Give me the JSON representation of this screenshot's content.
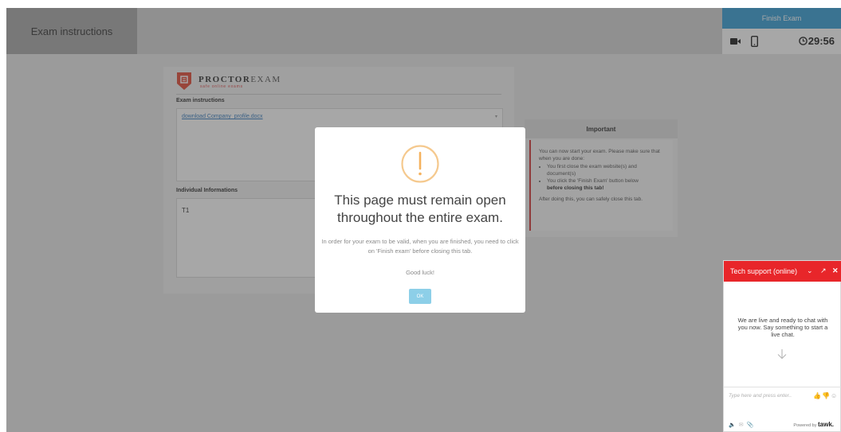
{
  "header": {
    "tab_label": "Exam instructions",
    "finish_label": "Finish Exam",
    "timer": "29:56",
    "camera_icon": "camera-icon",
    "phone_icon": "phone-icon"
  },
  "card": {
    "logo_brand": "PROCTOR",
    "logo_brand_light": "EXAM",
    "logo_tagline": "safe online exams",
    "exam_label": "Exam instructions",
    "download_link": "download Company_profile.docx",
    "indiv_label": "Individual Informations",
    "indiv_value": "T1"
  },
  "important": {
    "title": "Important",
    "intro": "You can now start your exam. Please make sure that when you are done:",
    "bullet1": "You first close the exam website(s) and document(s)",
    "bullet2_pre": "You click the 'Finish Exam' button below",
    "bullet2_bold": "before closing this tab!",
    "outro": "After doing this, you can safely close this tab."
  },
  "modal": {
    "title": "This page must remain open throughout the entire exam.",
    "text": "In order for your exam to be valid, when you are finished, you need to click on 'Finish exam' before closing this tab.",
    "luck": "Good luck!",
    "ok_label": "OK",
    "icon": "warning-icon"
  },
  "chat": {
    "title": "Tech support (online)",
    "minimize": "⌄",
    "popout": "↗",
    "close": "✕",
    "welcome": "We are live and ready to chat with you now. Say something to start a live chat.",
    "input_placeholder": "Type here and press enter..",
    "powered_prefix": "Powered by",
    "powered_brand": "tawk."
  },
  "colors": {
    "finish_button": "#3aa0d8",
    "chat_header": "#e8262a",
    "important_accent": "#d43b3b",
    "ok_button": "#8dcfe8"
  }
}
